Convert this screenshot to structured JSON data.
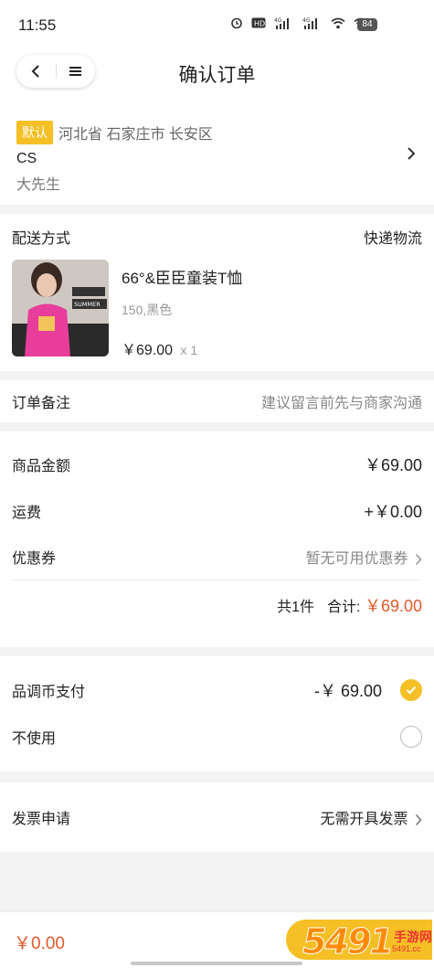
{
  "status_bar": {
    "time": "11:55",
    "icons": [
      "alarm-icon",
      "hd-icon",
      "signal-4g-icon",
      "signal-4g-icon",
      "wifi-icon",
      "wifi-icon"
    ],
    "battery": "84"
  },
  "nav": {
    "title": "确认订单",
    "back_icon": "back-arrow-icon",
    "menu_icon": "menu-icon"
  },
  "address": {
    "default_tag": "默认",
    "region": "河北省 石家庄市 长安区",
    "name": "CS",
    "person": "大先生"
  },
  "shipping": {
    "label": "配送方式",
    "value": "快递物流"
  },
  "goods": {
    "name": "66°&臣臣童装T恤",
    "spec": "150,黑色",
    "price": "￥69.00",
    "qty": "x 1",
    "image_text": "SUMMER"
  },
  "remark": {
    "label": "订单备注",
    "placeholder": "建议留言前先与商家沟通"
  },
  "summary": {
    "goods_amount_label": "商品金额",
    "goods_amount_value": "￥69.00",
    "freight_label": "运费",
    "freight_value": "+￥0.00",
    "coupon_label": "优惠券",
    "coupon_value": "暂无可用优惠券",
    "count_text": "共1件",
    "total_label": "合计:",
    "total_value": "￥69.00"
  },
  "payment": {
    "coin_label": "品调币支付",
    "coin_value": "-￥ 69.00",
    "none_label": "不使用"
  },
  "invoice": {
    "label": "发票申请",
    "value": "无需开具发票"
  },
  "bottom": {
    "total": "￥0.00"
  },
  "watermark": {
    "number": "5491",
    "text": "手游网",
    "url": "5491.cc"
  },
  "colors": {
    "accent": "#f5c026",
    "price_red": "#e05a2a",
    "background": "#f3f3f3"
  }
}
